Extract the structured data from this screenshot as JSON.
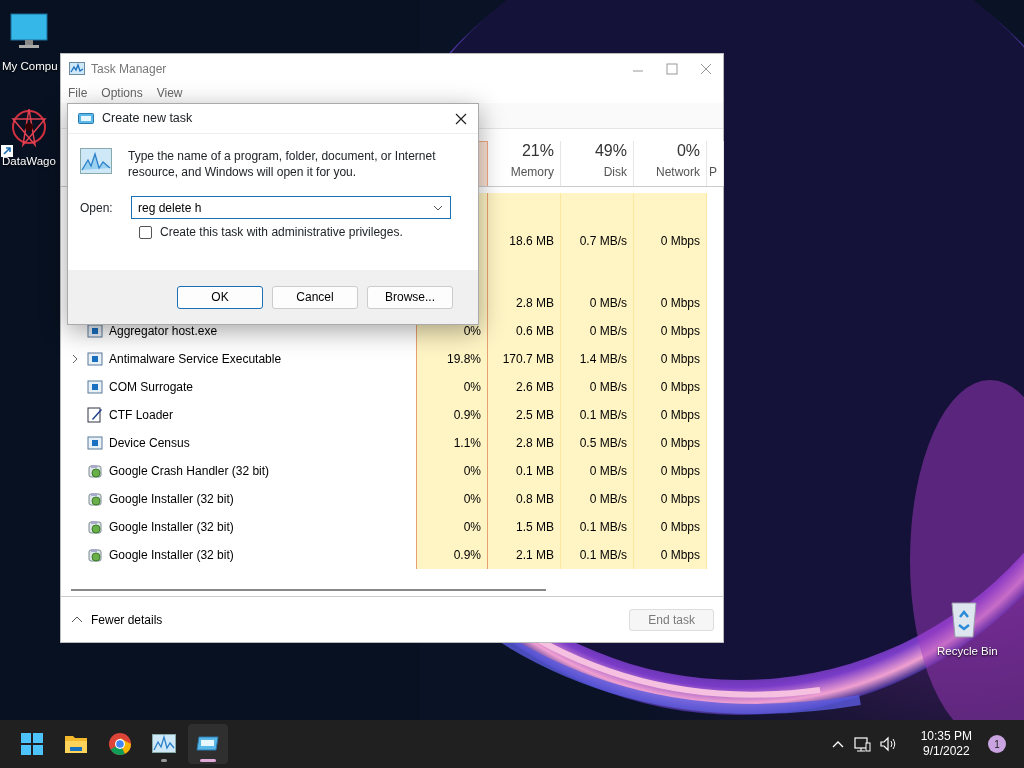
{
  "desktop_icons": [
    {
      "label": "My Compu",
      "kind": "computer",
      "shortcut": false
    },
    {
      "label": "DataWago",
      "kind": "app",
      "shortcut": true
    },
    {
      "label": "Recycle Bin",
      "kind": "bin",
      "shortcut": false
    }
  ],
  "task_manager": {
    "title": "Task Manager",
    "menu": [
      "File",
      "Options",
      "View"
    ],
    "columns": [
      {
        "percent": "21%",
        "label": "Memory"
      },
      {
        "percent": "49%",
        "label": "Disk"
      },
      {
        "percent": "0%",
        "label": "Network"
      },
      {
        "label": "P"
      }
    ],
    "rows": [
      {
        "kind": "group"
      },
      {
        "kind": "process",
        "memory": "18.6 MB",
        "disk": "0.7 MB/s",
        "network": "0 Mbps"
      },
      {
        "kind": "group"
      },
      {
        "kind": "process",
        "memory": "2.8 MB",
        "disk": "0 MB/s",
        "network": "0 Mbps"
      },
      {
        "kind": "service",
        "expandable": false,
        "name": "Aggregator host.exe",
        "cpu": "0%",
        "memory": "0.6 MB",
        "disk": "0 MB/s",
        "network": "0 Mbps"
      },
      {
        "kind": "service",
        "expandable": true,
        "name": "Antimalware Service Executable",
        "cpu": "19.8%",
        "memory": "170.7 MB",
        "disk": "1.4 MB/s",
        "network": "0 Mbps"
      },
      {
        "kind": "service",
        "expandable": false,
        "name": "COM Surrogate",
        "cpu": "0%",
        "memory": "2.6 MB",
        "disk": "0 MB/s",
        "network": "0 Mbps"
      },
      {
        "kind": "editor",
        "expandable": false,
        "name": "CTF Loader",
        "cpu": "0.9%",
        "memory": "2.5 MB",
        "disk": "0.1 MB/s",
        "network": "0 Mbps"
      },
      {
        "kind": "service",
        "expandable": false,
        "name": "Device Census",
        "cpu": "1.1%",
        "memory": "2.8 MB",
        "disk": "0.5 MB/s",
        "network": "0 Mbps"
      },
      {
        "kind": "installer",
        "expandable": false,
        "name": "Google Crash Handler (32 bit)",
        "cpu": "0%",
        "memory": "0.1 MB",
        "disk": "0 MB/s",
        "network": "0 Mbps"
      },
      {
        "kind": "installer",
        "expandable": false,
        "name": "Google Installer (32 bit)",
        "cpu": "0%",
        "memory": "0.8 MB",
        "disk": "0 MB/s",
        "network": "0 Mbps"
      },
      {
        "kind": "installer",
        "expandable": false,
        "name": "Google Installer (32 bit)",
        "cpu": "0%",
        "memory": "1.5 MB",
        "disk": "0.1 MB/s",
        "network": "0 Mbps"
      },
      {
        "kind": "installer",
        "expandable": false,
        "name": "Google Installer (32 bit)",
        "cpu": "0.9%",
        "memory": "2.1 MB",
        "disk": "0.1 MB/s",
        "network": "0 Mbps"
      }
    ],
    "fewer_details": "Fewer details",
    "end_task": {
      "label": "End task",
      "disabled": true
    }
  },
  "dialog": {
    "title": "Create new task",
    "description": "Type the name of a program, folder, document, or Internet resource, and Windows will open it for you.",
    "open_label": "Open:",
    "value": "reg delete h",
    "admin": {
      "label": "Create this task with administrative privileges.",
      "checked": false
    },
    "buttons": [
      {
        "label": "OK",
        "default": true
      },
      {
        "label": "Cancel",
        "default": false
      },
      {
        "label": "Browse...",
        "default": false
      }
    ]
  },
  "taskbar": {
    "apps": [
      {
        "kind": "start",
        "running": false,
        "selected": false
      },
      {
        "kind": "folder",
        "running": false,
        "selected": false
      },
      {
        "kind": "chrome",
        "running": false,
        "selected": false
      },
      {
        "kind": "taskmgr",
        "running": true,
        "selected": false
      },
      {
        "kind": "run",
        "running": true,
        "selected": true
      }
    ],
    "time": "10:35 PM",
    "date": "9/1/2022",
    "notifications": "1"
  }
}
